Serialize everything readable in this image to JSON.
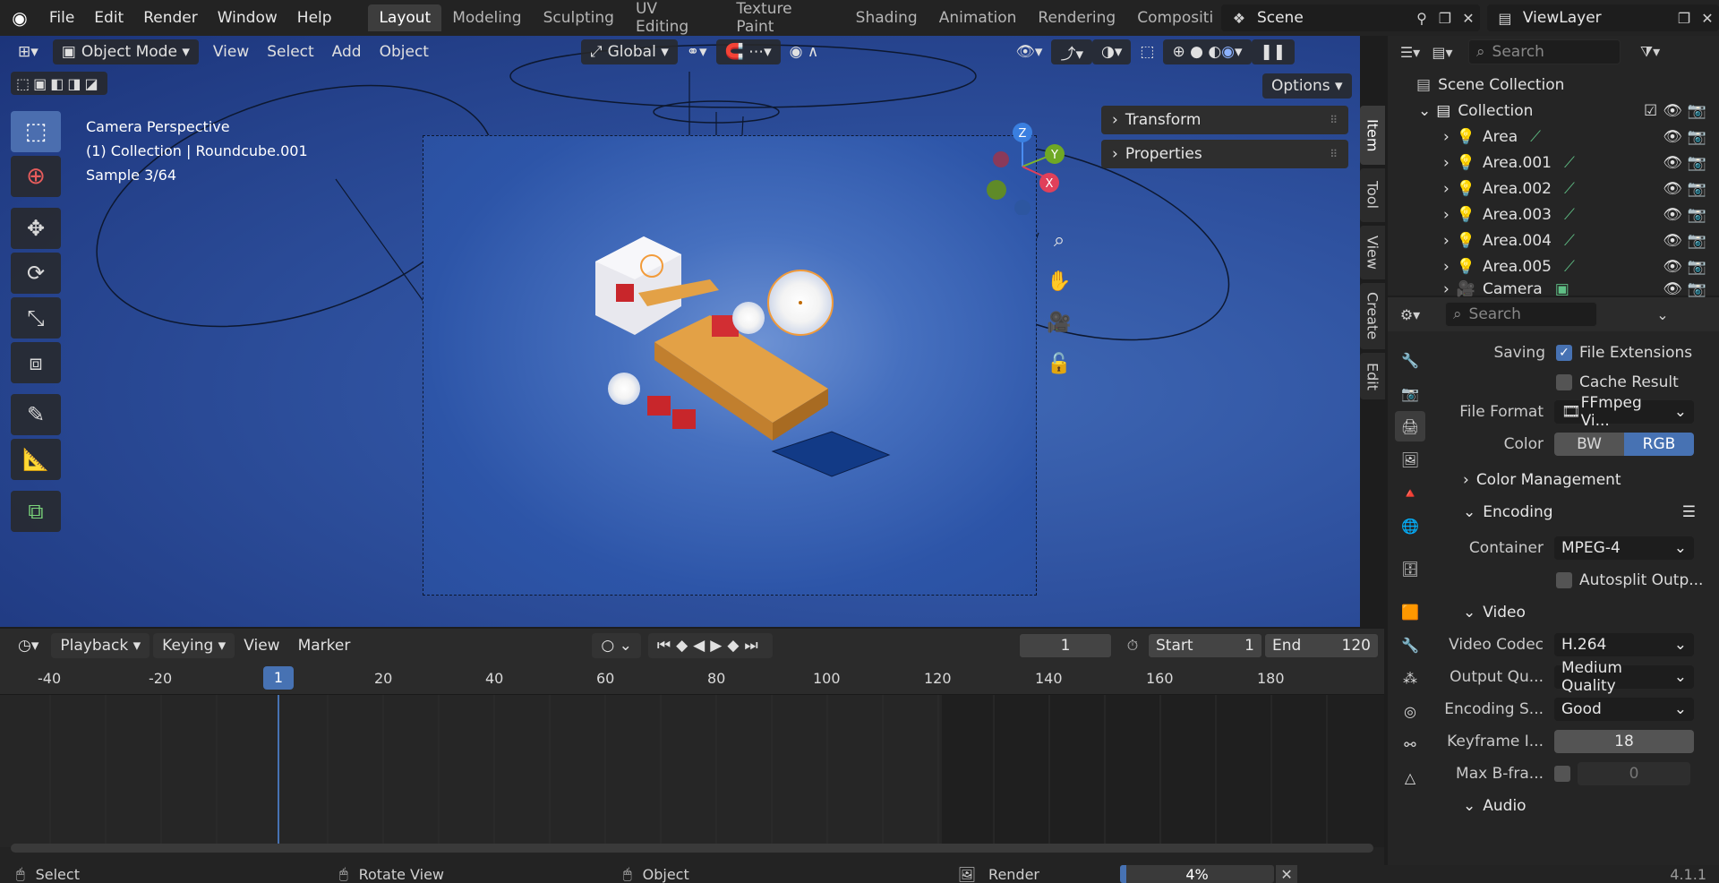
{
  "topbar": {
    "menus": [
      "File",
      "Edit",
      "Render",
      "Window",
      "Help"
    ],
    "workspaces": [
      "Layout",
      "Modeling",
      "Sculpting",
      "UV Editing",
      "Texture Paint",
      "Shading",
      "Animation",
      "Rendering",
      "Compositing"
    ],
    "active_workspace": "Layout",
    "scene": "Scene",
    "view_layer": "ViewLayer"
  },
  "viewport": {
    "mode": "Object Mode",
    "menus": [
      "View",
      "Select",
      "Add",
      "Object"
    ],
    "orientation": "Global",
    "options_label": "Options",
    "overlay_lines": [
      "Camera Perspective",
      "(1) Collection | Roundcube.001",
      "Sample 3/64"
    ],
    "npanel": {
      "transform": "Transform",
      "properties": "Properties"
    },
    "side_tabs": [
      "Item",
      "Tool",
      "View",
      "Create",
      "Edit"
    ],
    "gizmo": {
      "z": "Z",
      "y": "Y",
      "x": "X"
    },
    "colors": {
      "accent": "#4772b3",
      "bg_top": "#1c347a",
      "bg_mid": "#3f68b5"
    }
  },
  "timeline": {
    "menus": [
      "Playback",
      "Keying",
      "View",
      "Marker"
    ],
    "current_frame": "1",
    "start_label": "Start",
    "start_value": "1",
    "end_label": "End",
    "end_value": "120",
    "ruler": [
      "-40",
      "-20",
      "1",
      "20",
      "40",
      "60",
      "80",
      "100",
      "120",
      "140",
      "160",
      "180"
    ]
  },
  "outliner": {
    "search_placeholder": "Search",
    "root": "Scene Collection",
    "collection": "Collection",
    "items": [
      "Area",
      "Area.001",
      "Area.002",
      "Area.003",
      "Area.004",
      "Area.005",
      "Camera"
    ]
  },
  "properties": {
    "search_placeholder": "Search",
    "saving_label": "Saving",
    "file_extensions": "File Extensions",
    "cache_result": "Cache Result",
    "file_format_label": "File Format",
    "file_format_value": "FFmpeg Vi...",
    "color_label": "Color",
    "color_bw": "BW",
    "color_rgb": "RGB",
    "color_management": "Color Management",
    "encoding": "Encoding",
    "container_label": "Container",
    "container_value": "MPEG-4",
    "autosplit": "Autosplit Outp...",
    "video": "Video",
    "video_codec_label": "Video Codec",
    "video_codec_value": "H.264",
    "output_quality_label": "Output Qu...",
    "output_quality_value": "Medium Quality",
    "encoding_speed_label": "Encoding S...",
    "encoding_speed_value": "Good",
    "keyframe_label": "Keyframe I...",
    "keyframe_value": "18",
    "max_bframes_label": "Max B-fra...",
    "max_bframes_value": "0",
    "audio": "Audio"
  },
  "statusbar": {
    "select": "Select",
    "rotate": "Rotate View",
    "object": "Object",
    "render": "Render",
    "progress": "4%",
    "progress_value": 0.04,
    "version": "4.1.1"
  }
}
